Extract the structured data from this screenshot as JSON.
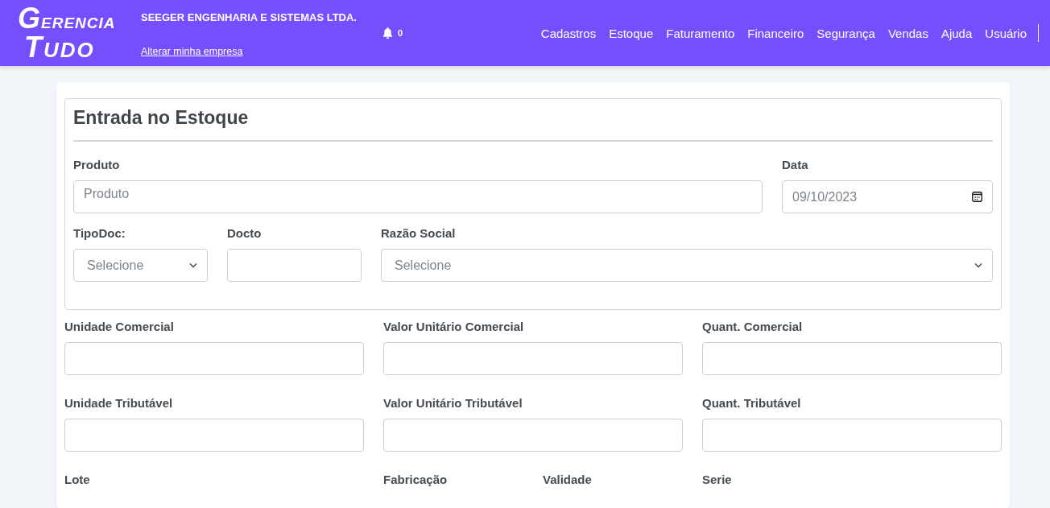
{
  "header": {
    "logo": {
      "line1": "GERENCIA",
      "line2": "TUDO"
    },
    "company": "SEEGER ENGENHARIA E SISTEMAS LTDA.",
    "change_company_link": "Alterar minha empresa",
    "notifications": {
      "count": "0"
    },
    "nav": [
      "Cadastros",
      "Estoque",
      "Faturamento",
      "Financeiro",
      "Segurança",
      "Vendas",
      "Ajuda",
      "Usuário"
    ]
  },
  "form": {
    "title": "Entrada no Estoque",
    "section_rows": [
      [
        {
          "kind": "text",
          "label": "Produto",
          "placeholder": "Produto"
        },
        {
          "kind": "date",
          "label": "Data",
          "value": "09/10/2023"
        }
      ],
      [
        {
          "kind": "select",
          "label": "TipoDoc:",
          "value": "Selecione"
        },
        {
          "kind": "text",
          "label": "Docto"
        },
        {
          "kind": "select",
          "label": "Razão Social",
          "value": "Selecione"
        }
      ]
    ],
    "rows": [
      [
        {
          "kind": "text",
          "label": "Unidade Comercial"
        },
        {
          "kind": "text",
          "label": "Valor Unitário Comercial"
        },
        {
          "kind": "text",
          "label": "Quant. Comercial"
        }
      ],
      [
        {
          "kind": "text",
          "label": "Unidade Tributável"
        },
        {
          "kind": "text",
          "label": "Valor Unitário Tributável"
        },
        {
          "kind": "text",
          "label": "Quant. Tributável"
        }
      ],
      [
        {
          "label": "Lote"
        },
        {
          "label": "Fabricação"
        },
        {
          "label": "Validade"
        },
        {
          "label": "Serie"
        }
      ]
    ]
  }
}
